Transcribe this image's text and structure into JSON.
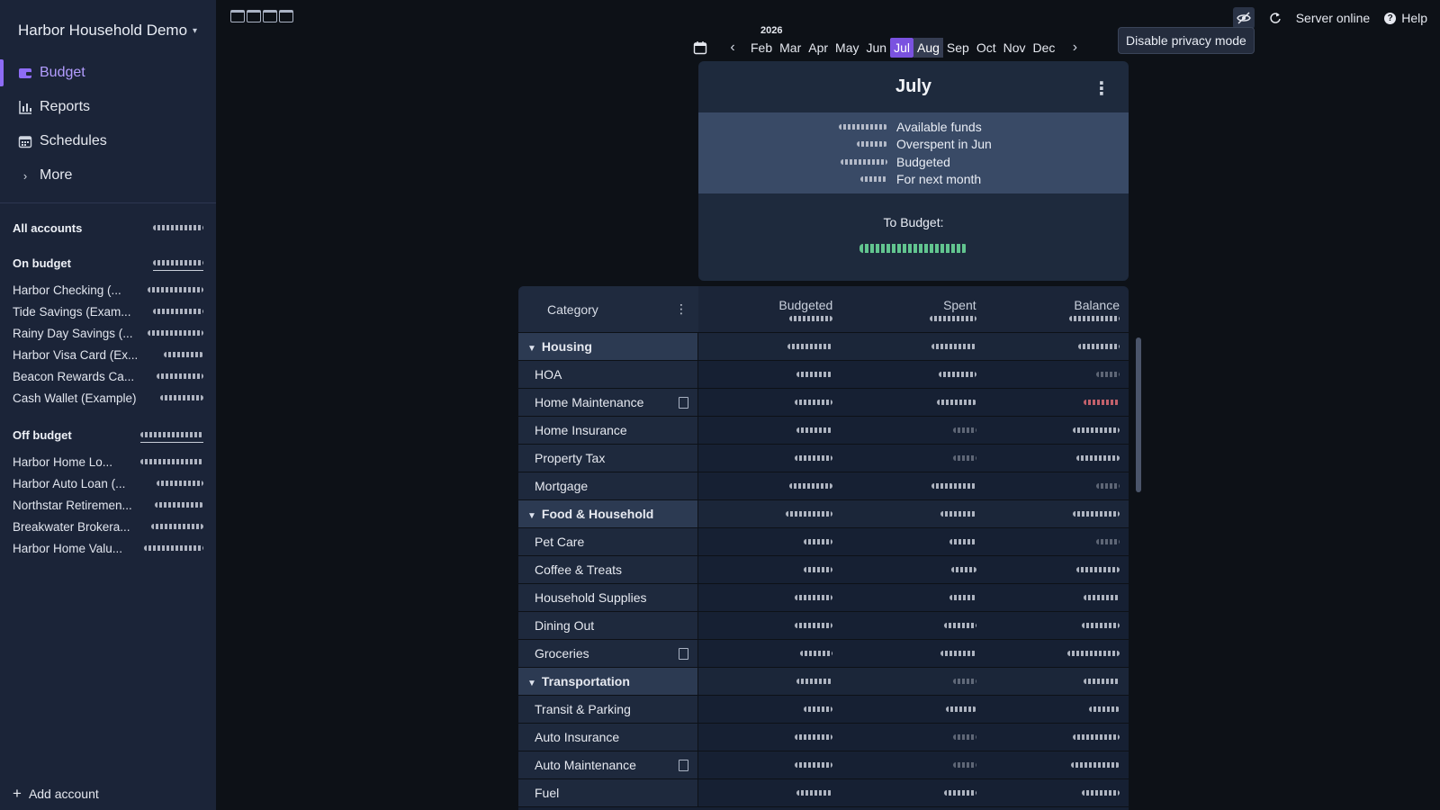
{
  "sidebar": {
    "budget_name": "Harbor Household Demo",
    "nav": [
      {
        "label": "Budget",
        "icon": "wallet-icon"
      },
      {
        "label": "Reports",
        "icon": "bar-chart-icon"
      },
      {
        "label": "Schedules",
        "icon": "calendar-icon"
      },
      {
        "label": "More",
        "icon": "chevron-right-icon"
      }
    ],
    "all_accounts": "All accounts",
    "on_budget": "On budget",
    "on_budget_accounts": [
      "Harbor Checking (...",
      "Tide Savings (Exam...",
      "Rainy Day Savings (...",
      "Harbor Visa Card (Ex...",
      "Beacon Rewards Ca...",
      "Cash Wallet (Example)"
    ],
    "off_budget": "Off budget",
    "off_budget_accounts": [
      "Harbor Home Lo...",
      "Harbor Auto Loan (...",
      "Northstar Retiremen...",
      "Breakwater Brokera...",
      "Harbor Home Valu..."
    ],
    "add_account": "Add account"
  },
  "topbar": {
    "server_status": "Server online",
    "help": "Help",
    "tooltip": "Disable privacy mode"
  },
  "month_picker": {
    "year": "2026",
    "months": [
      "Feb",
      "Mar",
      "Apr",
      "May",
      "Jun",
      "Jul",
      "Aug",
      "Sep",
      "Oct",
      "Nov",
      "Dec"
    ],
    "current": "Jul",
    "selected": "Aug"
  },
  "summary": {
    "month": "July",
    "lines": [
      "Available funds",
      "Overspent in Jun",
      "Budgeted",
      "For next month"
    ],
    "to_budget_label": "To Budget:"
  },
  "table": {
    "category_header": "Category",
    "columns": [
      "Budgeted",
      "Spent",
      "Balance"
    ],
    "rows": [
      {
        "label": "Housing",
        "group": true
      },
      {
        "label": "HOA"
      },
      {
        "label": "Home Maintenance",
        "note": true
      },
      {
        "label": "Home Insurance"
      },
      {
        "label": "Property Tax"
      },
      {
        "label": "Mortgage"
      },
      {
        "label": "Food & Household",
        "group": true
      },
      {
        "label": "Pet Care"
      },
      {
        "label": "Coffee & Treats"
      },
      {
        "label": "Household Supplies"
      },
      {
        "label": "Dining Out"
      },
      {
        "label": "Groceries",
        "note": true
      },
      {
        "label": "Transportation",
        "group": true
      },
      {
        "label": "Transit & Parking"
      },
      {
        "label": "Auto Insurance"
      },
      {
        "label": "Auto Maintenance",
        "note": true
      },
      {
        "label": "Fuel"
      }
    ]
  },
  "colors": {
    "accent": "#7a52e0",
    "sidebar_bg": "#1b2438",
    "positive": "#62c58f",
    "negative": "#e06c75"
  }
}
